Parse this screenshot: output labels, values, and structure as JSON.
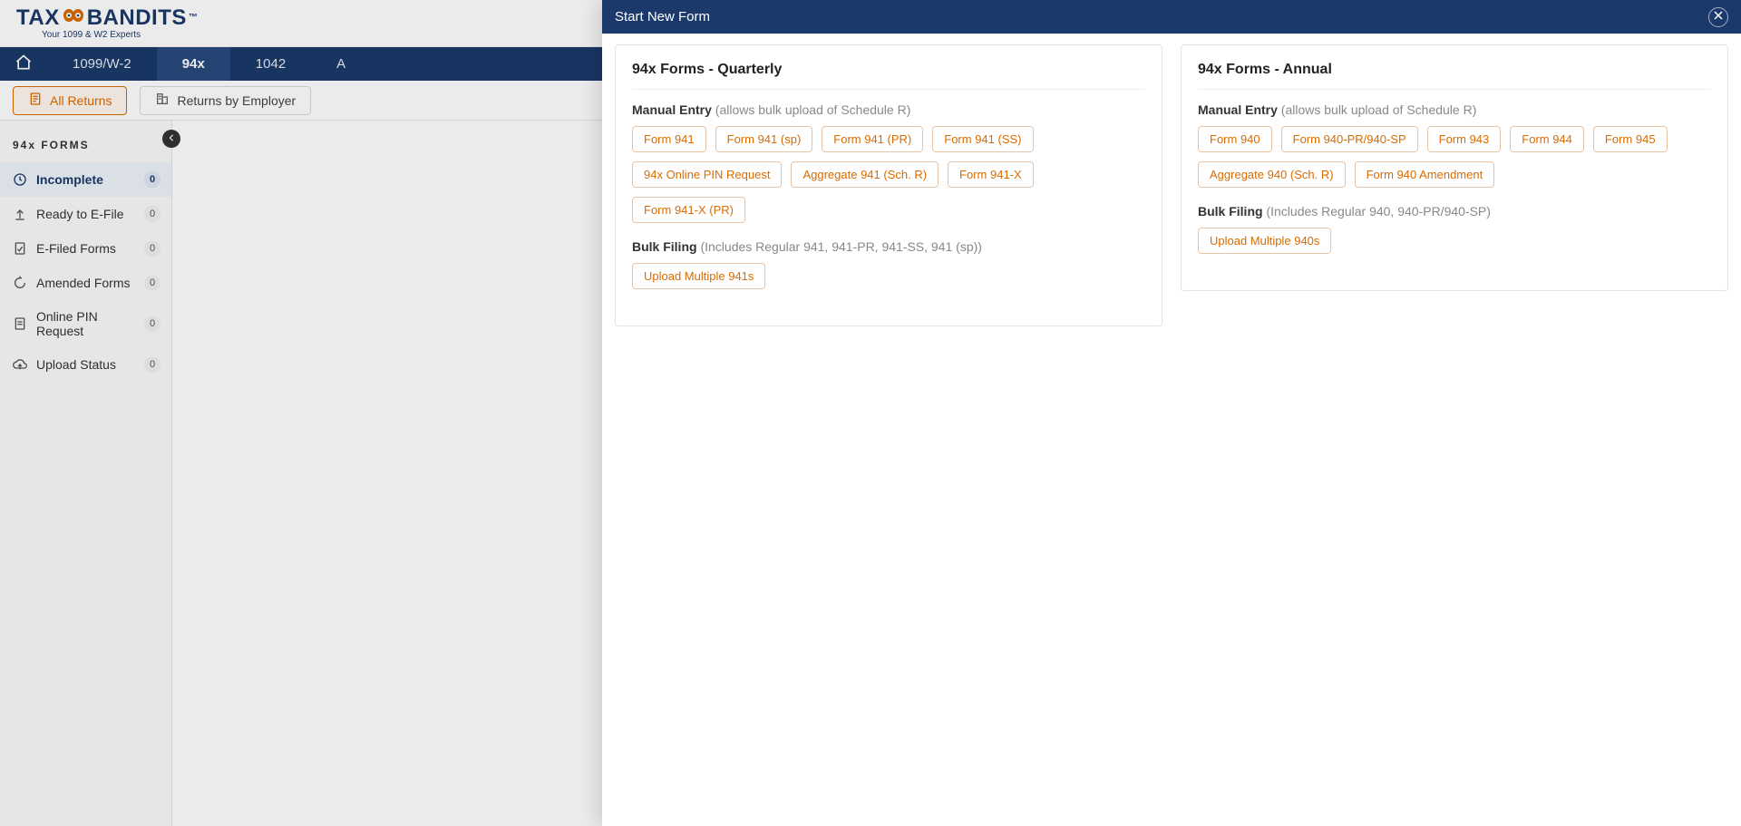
{
  "brand": {
    "name": "TAXBANDITS",
    "tagline": "Your 1099 & W2 Experts",
    "tm": "™"
  },
  "main_nav": {
    "home_label": "Home",
    "tabs": [
      {
        "label": "1099/W-2"
      },
      {
        "label": "94x"
      },
      {
        "label": "1042"
      },
      {
        "label": "A"
      }
    ],
    "active_index": 1
  },
  "sub_nav": {
    "all_returns": "All Returns",
    "returns_by_employer": "Returns by Employer"
  },
  "sidebar": {
    "title": "94x FORMS",
    "items": [
      {
        "key": "incomplete",
        "label": "Incomplete",
        "count": "0",
        "icon": "clock",
        "active": true
      },
      {
        "key": "ready",
        "label": "Ready to E-File",
        "count": "0",
        "icon": "upload",
        "active": false
      },
      {
        "key": "efiled",
        "label": "E-Filed Forms",
        "count": "0",
        "icon": "check",
        "active": false
      },
      {
        "key": "amended",
        "label": "Amended Forms",
        "count": "0",
        "icon": "refresh",
        "active": false
      },
      {
        "key": "pin",
        "label": "Online PIN Request",
        "count": "0",
        "icon": "doc",
        "active": false
      },
      {
        "key": "status",
        "label": "Upload Status",
        "count": "0",
        "icon": "cloud",
        "active": false
      }
    ]
  },
  "modal": {
    "title": "Start New Form",
    "quarterly": {
      "heading": "94x Forms - Quarterly",
      "manual_label": "Manual Entry",
      "manual_hint": "(allows bulk upload of Schedule R)",
      "manual_buttons": [
        "Form 941",
        "Form 941 (sp)",
        "Form 941 (PR)",
        "Form 941 (SS)",
        "94x Online PIN Request",
        "Aggregate 941 (Sch. R)",
        "Form 941-X",
        "Form 941-X (PR)"
      ],
      "bulk_label": "Bulk Filing",
      "bulk_hint": "(Includes Regular 941, 941-PR, 941-SS, 941 (sp))",
      "bulk_buttons": [
        "Upload Multiple 941s"
      ]
    },
    "annual": {
      "heading": "94x Forms - Annual",
      "manual_label": "Manual Entry",
      "manual_hint": "(allows bulk upload of Schedule R)",
      "manual_buttons": [
        "Form 940",
        "Form 940-PR/940-SP",
        "Form 943",
        "Form 944",
        "Form 945",
        "Aggregate 940 (Sch. R)",
        "Form 940 Amendment"
      ],
      "bulk_label": "Bulk Filing",
      "bulk_hint": "(Includes Regular 940, 940-PR/940-SP)",
      "bulk_buttons": [
        "Upload Multiple 940s"
      ]
    }
  }
}
